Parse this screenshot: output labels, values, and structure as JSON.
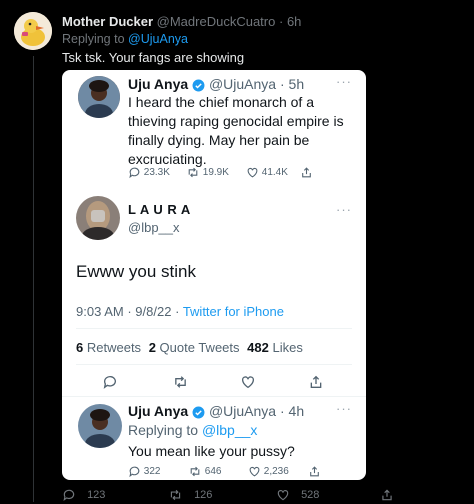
{
  "outer": {
    "author_name": "Mother Ducker",
    "author_handle": "@MadreDuckCuatro",
    "time": "6h",
    "replying_prefix": "Replying to",
    "replying_to": "@UjuAnya",
    "text": "Tsk tsk. Your fangs are showing",
    "stats": {
      "replies": "123",
      "retweets": "126",
      "likes": "528"
    }
  },
  "card": {
    "tweet1": {
      "name": "Uju Anya",
      "handle": "@UjuAnya",
      "time": "5h",
      "lines": [
        "I heard the chief monarch of a",
        "thieving raping genocidal empire is",
        "finally dying. May her pain be",
        "excruciating."
      ],
      "stats": {
        "replies": "23.3K",
        "retweets": "19.9K",
        "likes": "41.4K"
      }
    },
    "tweet2": {
      "name": "L A U R A",
      "handle": "@lbp__x",
      "text": "Ewww you stink",
      "time": "9:03 AM",
      "date": "9/8/22",
      "source": "Twitter for iPhone",
      "retweets_count": "6",
      "retweets_label": "Retweets",
      "quotes_count": "2",
      "quotes_label": "Quote Tweets",
      "likes_count": "482",
      "likes_label": "Likes"
    },
    "tweet3": {
      "name": "Uju Anya",
      "handle": "@UjuAnya",
      "time": "4h",
      "replying_prefix": "Replying to",
      "replying_to": "@lbp__x",
      "text": "You mean like your pussy?",
      "stats": {
        "replies": "322",
        "retweets": "646",
        "likes": "2,236"
      }
    }
  },
  "colors": {
    "accent": "#1d9bf0",
    "verified": "#1d9bf0",
    "background": "#000000",
    "card": "#ffffff"
  },
  "icons": [
    "reply-icon",
    "retweet-icon",
    "like-icon",
    "share-icon",
    "verified-icon",
    "more-icon"
  ]
}
